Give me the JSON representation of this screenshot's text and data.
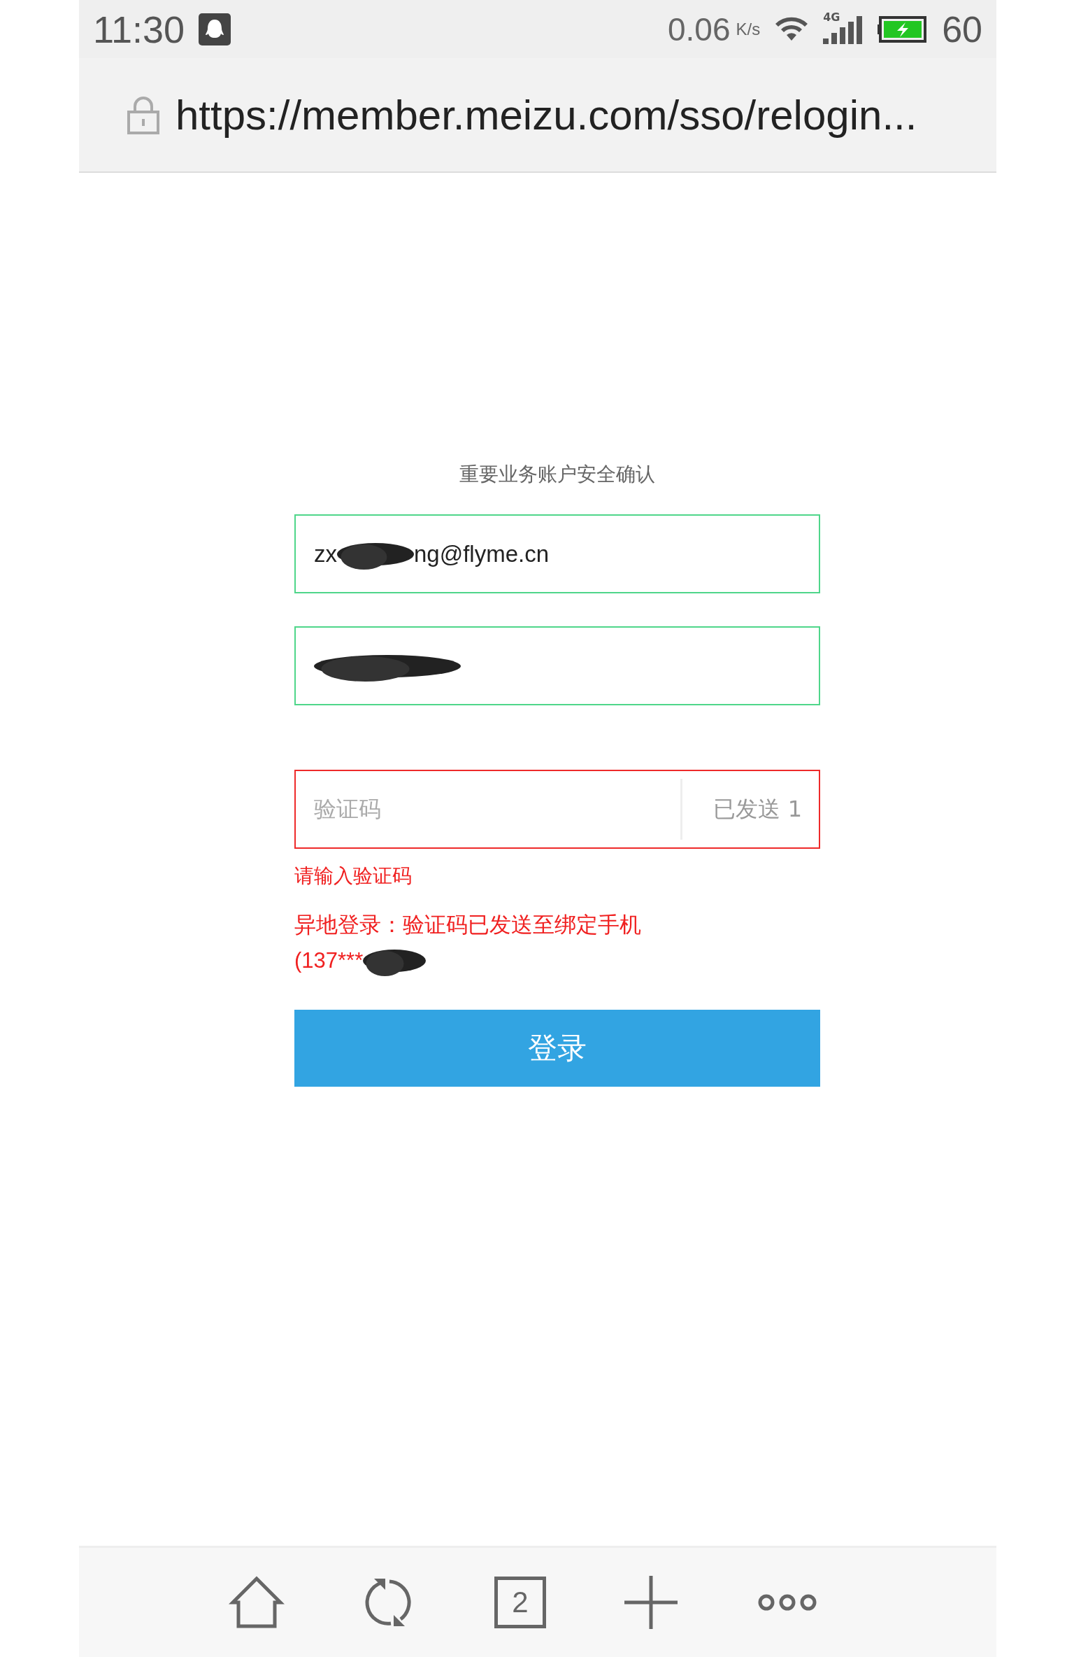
{
  "status_bar": {
    "time": "11:30",
    "speed": "0.06",
    "speed_unit": "K/s",
    "network": "4G",
    "battery": "60",
    "battery_charging": true
  },
  "address_bar": {
    "url": "https://member.meizu.com/sso/relogin...",
    "secure": true
  },
  "form": {
    "title": "重要业务账户安全确认",
    "fields": [
      {
        "kind": "email",
        "value_start": "zx",
        "value_end": "ng@flyme.cn",
        "error": false
      },
      {
        "kind": "password",
        "error": false
      },
      {
        "kind": "code",
        "placeholder": "验证码",
        "action": "已发送 1",
        "error": true
      }
    ],
    "error_message": "请输入验证码",
    "notice": "异地登录：验证码已发送至绑定手机",
    "notice_phone": "(137***",
    "submit": "登录"
  },
  "toolbar": {
    "tab_count": "2"
  }
}
